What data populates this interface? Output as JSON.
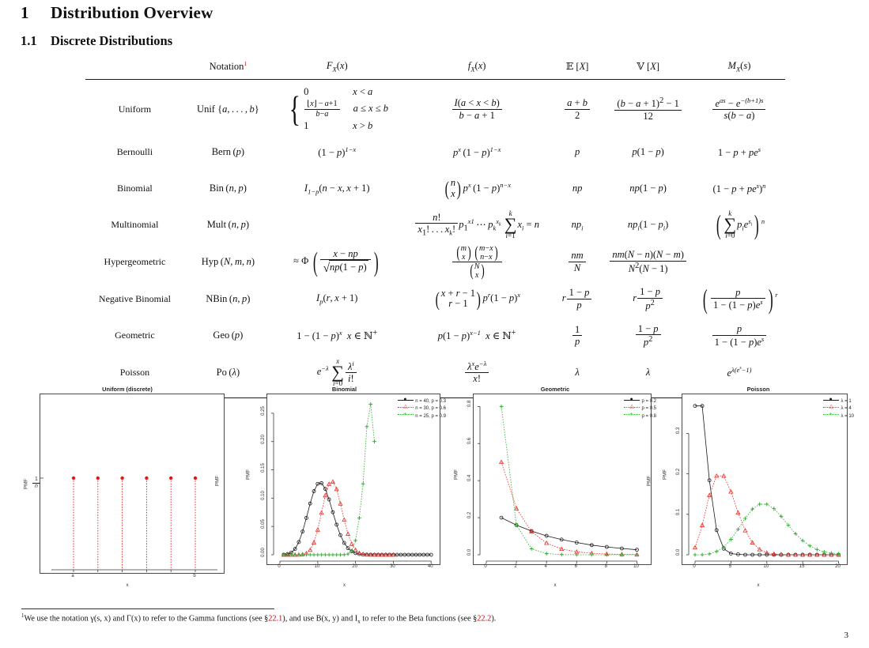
{
  "document": {
    "section_number": "1",
    "section_title": "Distribution Overview",
    "subsection_number": "1.1",
    "subsection_title": "Discrete Distributions",
    "page_number": "3",
    "footnote_marker": "1",
    "footnote_parts": {
      "p1": "We use the notation γ(s, x) and Γ(x) to refer to the Gamma functions (see §",
      "ref1": "22.1",
      "p2": "), and use B(x, y) and I",
      "sub1": "x",
      "p3": " to refer to the Beta functions (see §",
      "ref2": "22.2",
      "p4": ")."
    },
    "footnote_link_color": "#cc0000"
  },
  "table": {
    "headers": {
      "name": "",
      "notation": "Notation",
      "notation_footnote": "1",
      "cdf": "F_X(x)",
      "pdf": "f_X(x)",
      "mean": "E [X]",
      "variance": "V [X]",
      "mgf": "M_X(s)"
    },
    "rows": [
      {
        "name": "Uniform",
        "notation": "Unif {a, …, b}",
        "cdf": "0 for x < a ; (⌊x⌋ − a + 1)/(b − a) for a ≤ x ≤ b ; 1 for x > b",
        "cdf_cases": [
          {
            "value": "0",
            "cond": "x < a"
          },
          {
            "value": "(⌊x⌋−a+1)/(b−a)",
            "cond": "a ≤ x ≤ b"
          },
          {
            "value": "1",
            "cond": "x > b"
          }
        ],
        "pdf": "I(a < x < b) / (b − a + 1)",
        "mean": "(a + b)/2",
        "variance": "((b − a + 1)² − 1)/12",
        "mgf": "(e^{as} − e^{−(b+1)s})/(s(b − a))"
      },
      {
        "name": "Bernoulli",
        "notation": "Bern (p)",
        "cdf": "(1 − p)^{1−x}",
        "pdf": "p^x (1 − p)^{1−x}",
        "mean": "p",
        "variance": "p(1 − p)",
        "mgf": "1 − p + pe^s"
      },
      {
        "name": "Binomial",
        "notation": "Bin (n, p)",
        "cdf": "I_{1−p}(n − x, x + 1)",
        "pdf": "C(n, x) p^x (1 − p)^{n−x}",
        "mean": "np",
        "variance": "np(1 − p)",
        "mgf": "(1 − p + pe^s)^n"
      },
      {
        "name": "Multinomial",
        "notation": "Mult (n, p)",
        "cdf": "",
        "pdf": "n!/(x_1! … x_k!) p_1^{x_1} ⋯ p_k^{x_k} , Σ_{i=1}^{k} x_i = n",
        "mean": "np_i",
        "variance": "np_i(1 − p_i)",
        "mgf": "(Σ_{i=0}^{k} p_i e^{s_i})^n"
      },
      {
        "name": "Hypergeometric",
        "notation": "Hyp (N, m, n)",
        "cdf": "≈ Φ((x − np)/√(np(1 − p)))",
        "pdf": "C(m, x) C(m − x, n − x) / C(N, x)",
        "mean": "nm/N",
        "variance": "nm(N − n)(N − m)/(N²(N − 1))",
        "mgf": ""
      },
      {
        "name": "Negative Binomial",
        "notation": "NBin (n, p)",
        "cdf": "I_p(r, x + 1)",
        "pdf": "C(x + r − 1, r − 1) p^r (1 − p)^x",
        "mean": "r(1 − p)/p",
        "variance": "r(1 − p)/p²",
        "mgf": "(p/(1 − (1 − p)e^s))^r"
      },
      {
        "name": "Geometric",
        "notation": "Geo (p)",
        "cdf": "1 − (1 − p)^x , x ∈ ℕ⁺",
        "pdf": "p(1 − p)^{x−1} , x ∈ ℕ⁺",
        "mean": "1/p",
        "variance": "(1 − p)/p²",
        "mgf": "p/(1 − (1 − p)e^s)"
      },
      {
        "name": "Poisson",
        "notation": "Po (λ)",
        "cdf": "e^{−λ} Σ_{i=0}^{x} λ^i / i!",
        "pdf": "λ^x e^{−λ} / x!",
        "mean": "λ",
        "variance": "λ",
        "mgf": "e^{λ(e^s − 1)}"
      }
    ]
  },
  "colors": {
    "series_black": "#1a1a1a",
    "series_red": "#e8302a",
    "series_green": "#34b034",
    "uniform_point": "#ee1111",
    "axis": "#3a3a3a"
  },
  "chart_data": [
    {
      "id": "uniform",
      "type": "scatter",
      "title": "Uniform (discrete)",
      "xlabel": "x",
      "ylabel": "PMF",
      "ylabel_value": "1/n",
      "xtick_labels": [
        "a",
        "",
        "",
        "",
        "",
        "b"
      ],
      "x": [
        1,
        2,
        3,
        4,
        5,
        6
      ],
      "values": [
        1,
        1,
        1,
        1,
        1,
        1
      ],
      "ylim": [
        0,
        2.1
      ],
      "grid": false,
      "legend": null,
      "note": "six equal-height stems at height 1/n"
    },
    {
      "id": "binomial",
      "type": "line",
      "title": "Binomial",
      "xlabel": "x",
      "ylabel": "PMF",
      "xlim": [
        0,
        41
      ],
      "ylim": [
        0,
        0.275
      ],
      "xticks": [
        0,
        10,
        20,
        30,
        40
      ],
      "yticks": [
        0.0,
        0.05,
        0.1,
        0.15,
        0.2,
        0.25
      ],
      "ytick_labels": [
        "0.00",
        "0.05",
        "0.10",
        "0.15",
        "0.20",
        "0.25"
      ],
      "legend_position": "top-right",
      "series": [
        {
          "name": "n = 40, p = 0.3",
          "color": "#1a1a1a",
          "marker": "circle",
          "x": [
            1,
            2,
            3,
            4,
            5,
            6,
            7,
            8,
            9,
            10,
            11,
            12,
            13,
            14,
            15,
            16,
            17,
            18,
            19,
            20,
            21,
            22,
            23,
            24,
            25,
            26,
            27,
            28,
            29,
            30,
            31,
            32,
            33,
            34,
            35,
            36,
            37,
            38,
            39,
            40
          ],
          "values": [
            0.0002,
            0.0011,
            0.0038,
            0.0102,
            0.0224,
            0.0411,
            0.065,
            0.0905,
            0.1123,
            0.1253,
            0.1266,
            0.1163,
            0.0976,
            0.0751,
            0.0531,
            0.0347,
            0.0209,
            0.0117,
            0.006,
            0.0029,
            0.0013,
            0.0005,
            0.0002,
            0.0001,
            0,
            0,
            0,
            0,
            0,
            0,
            0,
            0,
            0,
            0,
            0,
            0,
            0,
            0,
            0,
            0
          ]
        },
        {
          "name": "n = 30, p = 0.6",
          "color": "#e8302a",
          "marker": "triangle",
          "x": [
            1,
            2,
            3,
            4,
            5,
            6,
            7,
            8,
            9,
            10,
            11,
            12,
            13,
            14,
            15,
            16,
            17,
            18,
            19,
            20,
            21,
            22,
            23,
            24,
            25,
            26,
            27,
            28,
            29,
            30
          ],
          "values": [
            0,
            0,
            0,
            0,
            0.0001,
            0.0006,
            0.0026,
            0.0085,
            0.0216,
            0.0441,
            0.0742,
            0.1047,
            0.1251,
            0.1289,
            0.116,
            0.0902,
            0.0617,
            0.0368,
            0.019,
            0.0085,
            0.0032,
            0.001,
            0.0003,
            0.0001,
            0,
            0,
            0,
            0,
            0,
            0
          ]
        },
        {
          "name": "n = 25, p = 0.9",
          "color": "#34b034",
          "marker": "plus",
          "x": [
            1,
            2,
            3,
            4,
            5,
            6,
            7,
            8,
            9,
            10,
            11,
            12,
            13,
            14,
            15,
            16,
            17,
            18,
            19,
            20,
            21,
            22,
            23,
            24,
            25
          ],
          "values": [
            0,
            0,
            0,
            0,
            0,
            0,
            0,
            0,
            0,
            0,
            0,
            0,
            0,
            0,
            0,
            0,
            0.0001,
            0.0013,
            0.007,
            0.0253,
            0.065,
            0.1253,
            0.2265,
            0.2659,
            0.2001
          ]
        }
      ]
    },
    {
      "id": "geometric",
      "type": "line",
      "title": "Geometric",
      "xlabel": "x",
      "ylabel": "PMF",
      "xlim": [
        0,
        10.5
      ],
      "ylim": [
        0,
        0.84
      ],
      "xticks": [
        0,
        2,
        4,
        6,
        8,
        10
      ],
      "yticks": [
        0.0,
        0.2,
        0.4,
        0.6,
        0.8
      ],
      "ytick_labels": [
        "0.0",
        "0.2",
        "0.4",
        "0.6",
        "0.8"
      ],
      "legend_position": "top-right",
      "series": [
        {
          "name": "p = 0.2",
          "color": "#1a1a1a",
          "marker": "circle",
          "x": [
            1,
            2,
            3,
            4,
            5,
            6,
            7,
            8,
            9,
            10
          ],
          "values": [
            0.2,
            0.16,
            0.128,
            0.102,
            0.082,
            0.066,
            0.052,
            0.042,
            0.034,
            0.027
          ]
        },
        {
          "name": "p = 0.5",
          "color": "#e8302a",
          "marker": "triangle",
          "x": [
            1,
            2,
            3,
            4,
            5,
            6,
            7,
            8,
            9,
            10
          ],
          "values": [
            0.5,
            0.25,
            0.125,
            0.063,
            0.031,
            0.016,
            0.008,
            0.004,
            0.002,
            0.001
          ]
        },
        {
          "name": "p = 0.8",
          "color": "#34b034",
          "marker": "plus",
          "x": [
            1,
            2,
            3,
            4,
            5,
            6,
            7,
            8,
            9,
            10
          ],
          "values": [
            0.8,
            0.16,
            0.032,
            0.006,
            0.001,
            0.0,
            0.0,
            0.0,
            0.0,
            0.0
          ]
        }
      ]
    },
    {
      "id": "poisson",
      "type": "line",
      "title": "Poisson",
      "xlabel": "x",
      "ylabel": "PMF",
      "xlim": [
        0,
        20.5
      ],
      "ylim": [
        0,
        0.385
      ],
      "xticks": [
        0,
        5,
        10,
        15,
        20
      ],
      "yticks": [
        0.0,
        0.1,
        0.2,
        0.3
      ],
      "ytick_labels": [
        "0.0",
        "0.1",
        "0.2",
        "0.3"
      ],
      "legend_position": "top-right",
      "series": [
        {
          "name": "λ = 1",
          "color": "#1a1a1a",
          "marker": "circle",
          "x": [
            0,
            1,
            2,
            3,
            4,
            5,
            6,
            7,
            8,
            9,
            10,
            11,
            12,
            13,
            14,
            15,
            16,
            17,
            18,
            19,
            20
          ],
          "values": [
            0.368,
            0.368,
            0.184,
            0.061,
            0.015,
            0.003,
            0.001,
            0,
            0,
            0,
            0,
            0,
            0,
            0,
            0,
            0,
            0,
            0,
            0,
            0,
            0
          ]
        },
        {
          "name": "λ = 4",
          "color": "#e8302a",
          "marker": "triangle",
          "x": [
            0,
            1,
            2,
            3,
            4,
            5,
            6,
            7,
            8,
            9,
            10,
            11,
            12,
            13,
            14,
            15,
            16,
            17,
            18,
            19,
            20
          ],
          "values": [
            0.018,
            0.073,
            0.147,
            0.195,
            0.195,
            0.156,
            0.104,
            0.06,
            0.03,
            0.013,
            0.005,
            0.002,
            0.001,
            0,
            0,
            0,
            0,
            0,
            0,
            0,
            0
          ]
        },
        {
          "name": "λ = 10",
          "color": "#34b034",
          "marker": "plus",
          "x": [
            0,
            1,
            2,
            3,
            4,
            5,
            6,
            7,
            8,
            9,
            10,
            11,
            12,
            13,
            14,
            15,
            16,
            17,
            18,
            19,
            20
          ],
          "values": [
            0.0,
            0.0,
            0.002,
            0.008,
            0.019,
            0.038,
            0.063,
            0.09,
            0.113,
            0.125,
            0.125,
            0.114,
            0.095,
            0.073,
            0.052,
            0.035,
            0.022,
            0.013,
            0.007,
            0.004,
            0.002
          ]
        }
      ]
    }
  ]
}
